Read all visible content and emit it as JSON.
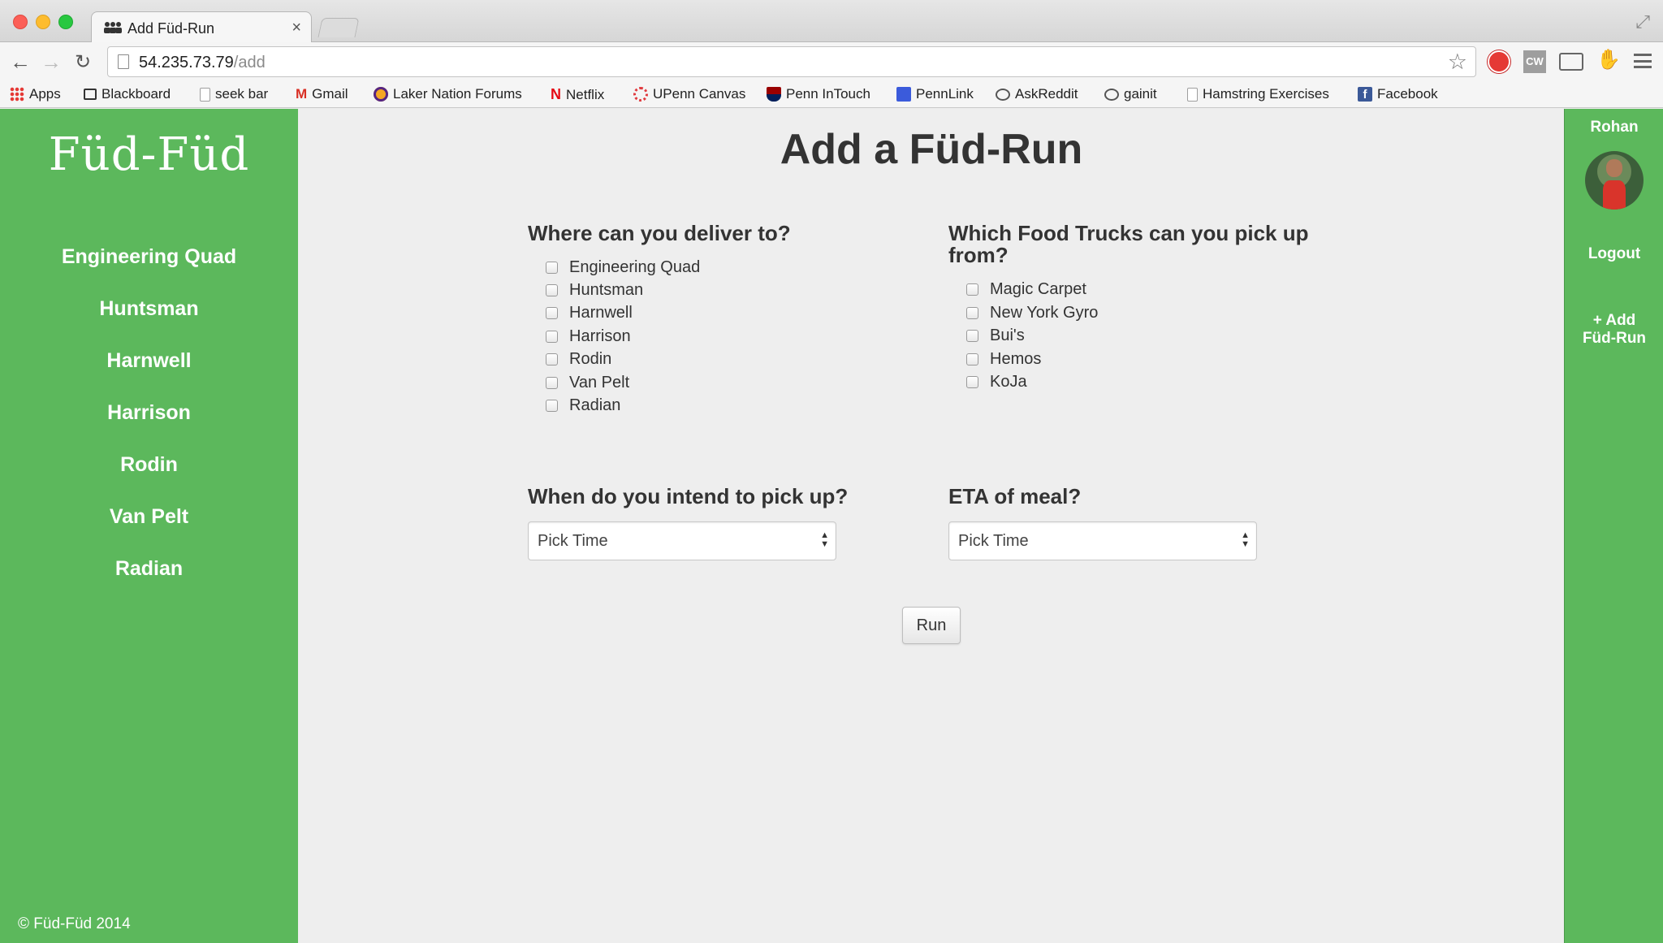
{
  "browser": {
    "tab_title": "Add Füd-Run",
    "url_host": "54.235.73.79",
    "url_path": "/add",
    "bookmarks": [
      {
        "label": "Apps",
        "icon": "apps-grid-icon",
        "color": "#e53935"
      },
      {
        "label": "Blackboard",
        "icon": "blackboard-icon",
        "color": "#333333"
      },
      {
        "label": "seek bar",
        "icon": "page-icon",
        "color": "#9e9e9e"
      },
      {
        "label": "Gmail",
        "icon": "gmail-icon",
        "color": "#d93025"
      },
      {
        "label": "Laker Nation Forums",
        "icon": "laker-icon",
        "color": "#f5a623"
      },
      {
        "label": "Netflix",
        "icon": "netflix-icon",
        "color": "#e50914"
      },
      {
        "label": "UPenn Canvas",
        "icon": "canvas-icon",
        "color": "#e03a3e"
      },
      {
        "label": "Penn InTouch",
        "icon": "penn-shield-icon",
        "color": "#011f5b"
      },
      {
        "label": "PennLink",
        "icon": "pennlink-icon",
        "color": "#3b5bdb"
      },
      {
        "label": "AskReddit",
        "icon": "reddit-icon",
        "color": "#555555"
      },
      {
        "label": "gainit",
        "icon": "reddit-icon",
        "color": "#555555"
      },
      {
        "label": "Hamstring Exercises",
        "icon": "page-icon",
        "color": "#9e9e9e"
      },
      {
        "label": "Facebook",
        "icon": "facebook-icon",
        "color": "#3b5998"
      }
    ]
  },
  "sidebar": {
    "logo": "Füd-Füd",
    "links": [
      "Engineering Quad",
      "Huntsman",
      "Harnwell",
      "Harrison",
      "Rodin",
      "Van Pelt",
      "Radian"
    ],
    "footer": "© Füd-Füd 2014"
  },
  "user": {
    "name": "Rohan",
    "logout_label": "Logout",
    "add_run_line1": "+ Add",
    "add_run_line2": "Füd-Run"
  },
  "form": {
    "title": "Add a Füd-Run",
    "deliver_label": "Where can you deliver to?",
    "deliver_options": [
      "Engineering Quad",
      "Huntsman",
      "Harnwell",
      "Harrison",
      "Rodin",
      "Van Pelt",
      "Radian"
    ],
    "trucks_label_line1": "Which Food Trucks can you pick up",
    "trucks_label_line2": "from?",
    "truck_options": [
      "Magic Carpet",
      "New York Gyro",
      "Bui's",
      "Hemos",
      "KoJa"
    ],
    "pickup_label": "When do you intend to pick up?",
    "pickup_value": "Pick Time",
    "eta_label": "ETA of meal?",
    "eta_value": "Pick Time",
    "submit_label": "Run"
  },
  "colors": {
    "sidebar_green": "#5cb85c",
    "main_bg": "#eeeeee",
    "text_dark": "#333333"
  }
}
